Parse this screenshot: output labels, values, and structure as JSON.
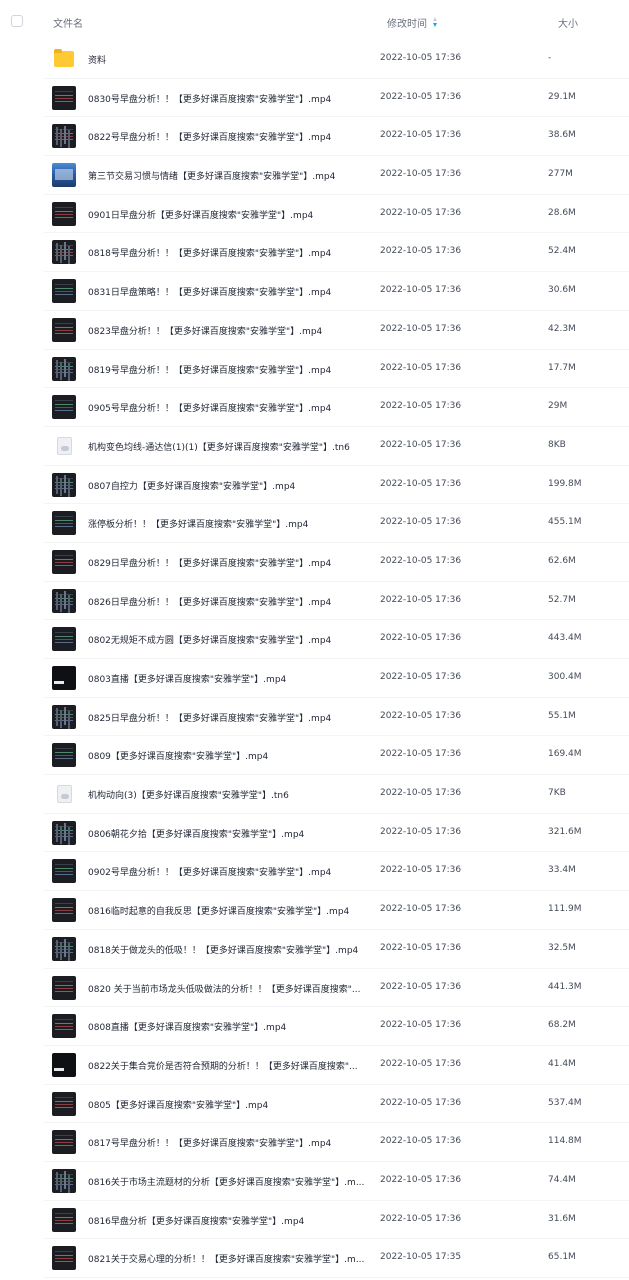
{
  "header": {
    "name_label": "文件名",
    "date_label": "修改时间",
    "size_label": "大小"
  },
  "rows": [
    {
      "icon": "folder-icon",
      "name": "资料",
      "date": "2022-10-05 17:36",
      "size": "-"
    },
    {
      "icon": "video-thumbnail",
      "name": "0830号早盘分析！！【更多好课百度搜索\"安雅学堂\"】.mp4",
      "date": "2022-10-05 17:36",
      "size": "29.1M"
    },
    {
      "icon": "video-thumbnail",
      "name": "0822号早盘分析！！【更多好课百度搜索\"安雅学堂\"】.mp4",
      "date": "2022-10-05 17:36",
      "size": "38.6M"
    },
    {
      "icon": "image-thumbnail",
      "name": "第三节交易习惯与情绪【更多好课百度搜索\"安雅学堂\"】.mp4",
      "date": "2022-10-05 17:36",
      "size": "277M"
    },
    {
      "icon": "video-thumbnail",
      "name": "0901日早盘分析【更多好课百度搜索\"安雅学堂\"】.mp4",
      "date": "2022-10-05 17:36",
      "size": "28.6M"
    },
    {
      "icon": "video-thumbnail",
      "name": "0818号早盘分析！！【更多好课百度搜索\"安雅学堂\"】.mp4",
      "date": "2022-10-05 17:36",
      "size": "52.4M"
    },
    {
      "icon": "video-thumbnail",
      "name": "0831日早盘策略！！【更多好课百度搜索\"安雅学堂\"】.mp4",
      "date": "2022-10-05 17:36",
      "size": "30.6M"
    },
    {
      "icon": "video-thumbnail",
      "name": "0823早盘分析！！【更多好课百度搜索\"安雅学堂\"】.mp4",
      "date": "2022-10-05 17:36",
      "size": "42.3M"
    },
    {
      "icon": "video-thumbnail",
      "name": "0819号早盘分析！！【更多好课百度搜索\"安雅学堂\"】.mp4",
      "date": "2022-10-05 17:36",
      "size": "17.7M"
    },
    {
      "icon": "video-thumbnail",
      "name": "0905号早盘分析！！【更多好课百度搜索\"安雅学堂\"】.mp4",
      "date": "2022-10-05 17:36",
      "size": "29M"
    },
    {
      "icon": "file-icon",
      "name": "机构变色均线-通达信(1)(1)【更多好课百度搜索\"安雅学堂\"】.tn6",
      "date": "2022-10-05 17:36",
      "size": "8KB"
    },
    {
      "icon": "video-thumbnail",
      "name": "0807自控力【更多好课百度搜索\"安雅学堂\"】.mp4",
      "date": "2022-10-05 17:36",
      "size": "199.8M"
    },
    {
      "icon": "video-thumbnail",
      "name": "涨停板分析！！【更多好课百度搜索\"安雅学堂\"】.mp4",
      "date": "2022-10-05 17:36",
      "size": "455.1M"
    },
    {
      "icon": "video-thumbnail",
      "name": "0829日早盘分析！！【更多好课百度搜索\"安雅学堂\"】.mp4",
      "date": "2022-10-05 17:36",
      "size": "62.6M"
    },
    {
      "icon": "video-thumbnail",
      "name": "0826日早盘分析！！【更多好课百度搜索\"安雅学堂\"】.mp4",
      "date": "2022-10-05 17:36",
      "size": "52.7M"
    },
    {
      "icon": "video-thumbnail",
      "name": "0802无规矩不成方圆【更多好课百度搜索\"安雅学堂\"】.mp4",
      "date": "2022-10-05 17:36",
      "size": "443.4M"
    },
    {
      "icon": "dark-thumbnail",
      "name": "0803直播【更多好课百度搜索\"安雅学堂\"】.mp4",
      "date": "2022-10-05 17:36",
      "size": "300.4M"
    },
    {
      "icon": "video-thumbnail",
      "name": "0825日早盘分析！！【更多好课百度搜索\"安雅学堂\"】.mp4",
      "date": "2022-10-05 17:36",
      "size": "55.1M"
    },
    {
      "icon": "video-thumbnail",
      "name": "0809【更多好课百度搜索\"安雅学堂\"】.mp4",
      "date": "2022-10-05 17:36",
      "size": "169.4M"
    },
    {
      "icon": "file-icon",
      "name": "机构动向(3)【更多好课百度搜索\"安雅学堂\"】.tn6",
      "date": "2022-10-05 17:36",
      "size": "7KB"
    },
    {
      "icon": "video-thumbnail",
      "name": "0806朝花夕拾【更多好课百度搜索\"安雅学堂\"】.mp4",
      "date": "2022-10-05 17:36",
      "size": "321.6M"
    },
    {
      "icon": "video-thumbnail",
      "name": "0902号早盘分析！！【更多好课百度搜索\"安雅学堂\"】.mp4",
      "date": "2022-10-05 17:36",
      "size": "33.4M"
    },
    {
      "icon": "video-thumbnail",
      "name": "0816临时起意的自我反思【更多好课百度搜索\"安雅学堂\"】.mp4",
      "date": "2022-10-05 17:36",
      "size": "111.9M"
    },
    {
      "icon": "video-thumbnail",
      "name": "0818关于做龙头的低吸！！【更多好课百度搜索\"安雅学堂\"】.mp4",
      "date": "2022-10-05 17:36",
      "size": "32.5M"
    },
    {
      "icon": "video-thumbnail",
      "name": "0820 关于当前市场龙头低吸做法的分析！！【更多好课百度搜索\"...",
      "date": "2022-10-05 17:36",
      "size": "441.3M"
    },
    {
      "icon": "video-thumbnail",
      "name": "0808直播【更多好课百度搜索\"安雅学堂\"】.mp4",
      "date": "2022-10-05 17:36",
      "size": "68.2M"
    },
    {
      "icon": "dark-thumbnail",
      "name": "0822关于集合竞价是否符合预期的分析！！【更多好课百度搜索\"...",
      "date": "2022-10-05 17:36",
      "size": "41.4M"
    },
    {
      "icon": "video-thumbnail",
      "name": "0805【更多好课百度搜索\"安雅学堂\"】.mp4",
      "date": "2022-10-05 17:36",
      "size": "537.4M"
    },
    {
      "icon": "video-thumbnail",
      "name": "0817号早盘分析！！【更多好课百度搜索\"安雅学堂\"】.mp4",
      "date": "2022-10-05 17:36",
      "size": "114.8M"
    },
    {
      "icon": "video-thumbnail",
      "name": "0816关于市场主流题材的分析【更多好课百度搜索\"安雅学堂\"】.m...",
      "date": "2022-10-05 17:36",
      "size": "74.4M"
    },
    {
      "icon": "video-thumbnail",
      "name": "0816早盘分析【更多好课百度搜索\"安雅学堂\"】.mp4",
      "date": "2022-10-05 17:36",
      "size": "31.6M"
    },
    {
      "icon": "video-thumbnail",
      "name": "0821关于交易心理的分析！！【更多好课百度搜索\"安雅学堂\"】.m...",
      "date": "2022-10-05 17:35",
      "size": "65.1M"
    }
  ],
  "colors": {
    "accent": "#06a7ff",
    "folder": "#ffc933"
  }
}
